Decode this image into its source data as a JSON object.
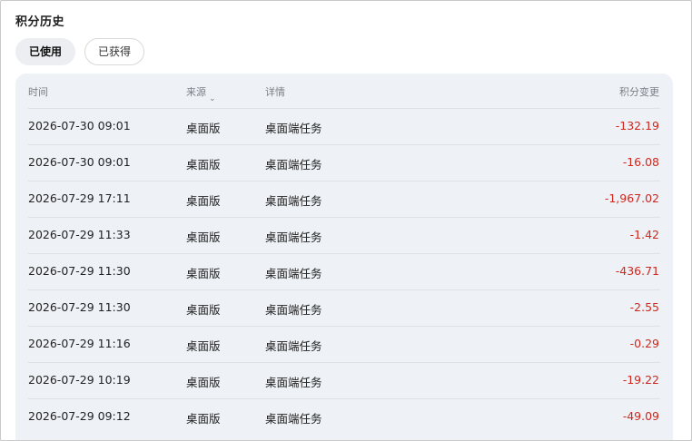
{
  "page": {
    "title": "积分历史"
  },
  "tabs": [
    {
      "label": "已使用",
      "active": true
    },
    {
      "label": "已获得",
      "active": false
    }
  ],
  "table": {
    "headers": {
      "time": "时间",
      "source": "来源",
      "detail": "详情",
      "change": "积分变更"
    },
    "rows": [
      {
        "time": "2026-07-30 09:01",
        "source": "桌面版",
        "detail": "桌面端任务",
        "change": "-132.19"
      },
      {
        "time": "2026-07-30 09:01",
        "source": "桌面版",
        "detail": "桌面端任务",
        "change": "-16.08"
      },
      {
        "time": "2026-07-29 17:11",
        "source": "桌面版",
        "detail": "桌面端任务",
        "change": "-1,967.02"
      },
      {
        "time": "2026-07-29 11:33",
        "source": "桌面版",
        "detail": "桌面端任务",
        "change": "-1.42"
      },
      {
        "time": "2026-07-29 11:30",
        "source": "桌面版",
        "detail": "桌面端任务",
        "change": "-436.71"
      },
      {
        "time": "2026-07-29 11:30",
        "source": "桌面版",
        "detail": "桌面端任务",
        "change": "-2.55"
      },
      {
        "time": "2026-07-29 11:16",
        "source": "桌面版",
        "detail": "桌面端任务",
        "change": "-0.29"
      },
      {
        "time": "2026-07-29 10:19",
        "source": "桌面版",
        "detail": "桌面端任务",
        "change": "-19.22"
      },
      {
        "time": "2026-07-29 09:12",
        "source": "桌面版",
        "detail": "桌面端任务",
        "change": "-49.09"
      }
    ]
  },
  "colors": {
    "negative": "#d0271e",
    "panel_bg": "#eef2f6",
    "active_tab_bg": "#eceef1"
  },
  "icons": {
    "source_sort": "chevron-down-icon"
  }
}
